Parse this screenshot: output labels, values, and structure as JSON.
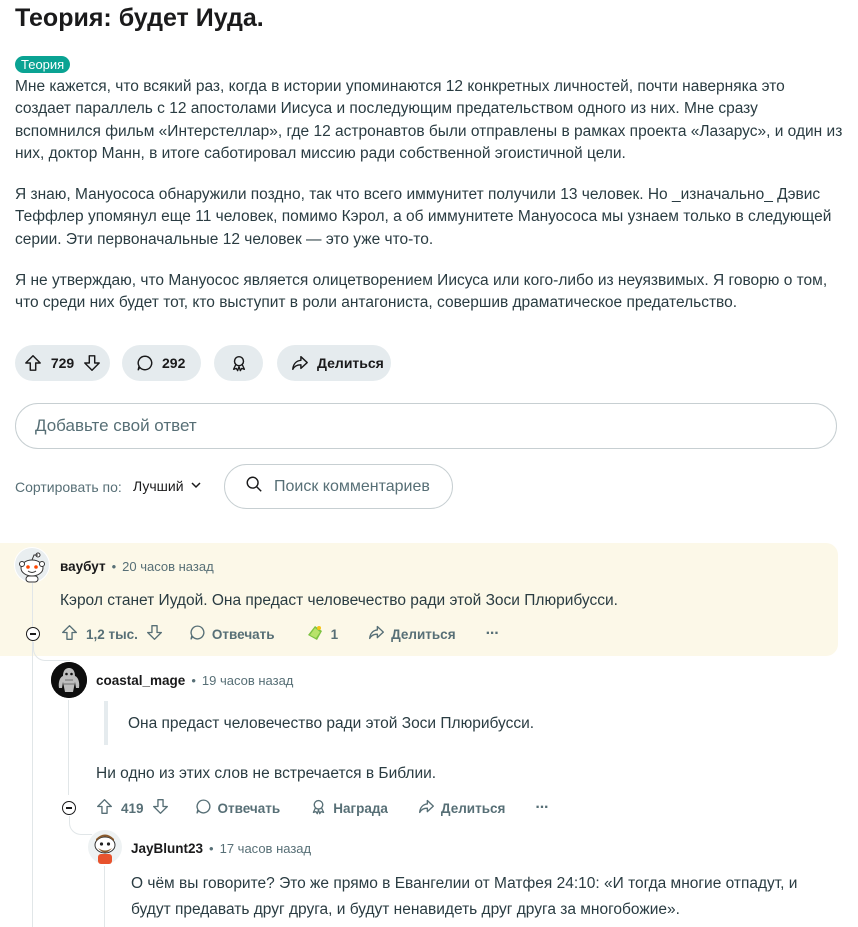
{
  "post": {
    "title": "Теория: будет Иуда.",
    "flair": "Теория",
    "paragraphs": [
      "Мне кажется, что всякий раз, когда в истории упоминаются 12 конкретных личностей, почти наверняка это создает параллель с 12 апостолами Иисуса и последующим предательством одного из них. Мне сразу вспомнился фильм «Интерстеллар», где 12 астронавтов были отправлены в рамках проекта «Лазарус», и один из них, доктор Манн, в итоге саботировал миссию ради собственной эгоистичной цели.",
      "Я знаю, Мануососа обнаружили поздно, так что всего иммунитет получили 13 человек. Но _изначально_ Дэвис Теффлер упомянул еще 11 человек, помимо Кэрол, а об иммунитете Мануососа мы узнаем только в следующей серии. Эти первоначальные 12 человек — это уже что-то.",
      "Я не утверждаю, что Мануосос является олицетворением Иисуса или кого-либо из неуязвимых. Я говорю о том, что среди них будет тот, кто выступит в роли антагониста, совершив драматическое предательство."
    ],
    "votes": "729",
    "comments": "292",
    "share_label": "Делиться"
  },
  "reply_box": {
    "placeholder": "Добавьте свой ответ"
  },
  "sort": {
    "label": "Сортировать по:",
    "value": "Лучший"
  },
  "search": {
    "placeholder": "Поиск комментариев"
  },
  "comments": [
    {
      "user": "ваубут",
      "time": "20 часов назад",
      "text": "Кэрол станет Иудой. Она предаст человечество ради этой Зоси Плюрибусси.",
      "votes": "1,2 тыс.",
      "reply_label": "Отвечать",
      "award_count": "1",
      "share_label": "Делиться",
      "more": "···"
    },
    {
      "user": "coastal_mage",
      "time": "19 часов назад",
      "quote": "Она предаст человечество ради этой Зоси Плюрибусси.",
      "text": "Ни одно из этих слов не встречается в Библии.",
      "votes": "419",
      "reply_label": "Отвечать",
      "award_label": "Награда",
      "share_label": "Делиться",
      "more": "···"
    },
    {
      "user": "JayBlunt23",
      "time": "17 часов назад",
      "text_lines": [
        "О чём вы говорите? Это же прямо в Евангелии от Матфея 24:10: «И тогда многие отпадут, и",
        "будут предавать друг друга, и будут ненавидеть друг друга за многобожие»."
      ]
    }
  ],
  "colors": {
    "flair": "#0aa393",
    "pill": "#e5ebee",
    "highlight": "#fcf8e8",
    "text": "#2a3c42",
    "muted": "#576f76"
  },
  "separator": "•"
}
